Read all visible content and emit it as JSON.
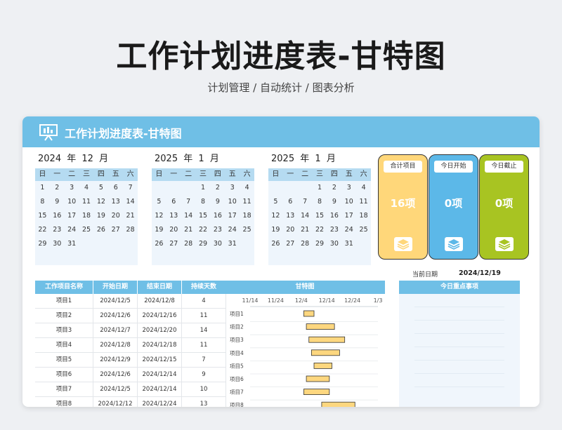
{
  "page": {
    "title": "工作计划进度表-甘特图",
    "subtitle": "计划管理 / 自动统计 / 图表分析"
  },
  "banner": {
    "title": "工作计划进度表-甘特图"
  },
  "calendars": [
    {
      "year": "2024",
      "year_unit": "年",
      "month": "12",
      "month_unit": "月",
      "weekdays": [
        "日",
        "一",
        "二",
        "三",
        "四",
        "五",
        "六"
      ],
      "rows": [
        [
          "1",
          "2",
          "3",
          "4",
          "5",
          "6",
          "7"
        ],
        [
          "8",
          "9",
          "10",
          "11",
          "12",
          "13",
          "14"
        ],
        [
          "15",
          "16",
          "17",
          "18",
          "19",
          "20",
          "21"
        ],
        [
          "22",
          "23",
          "24",
          "25",
          "26",
          "27",
          "28"
        ],
        [
          "29",
          "30",
          "31",
          "",
          "",
          "",
          ""
        ],
        [
          "",
          "",
          "",
          "",
          "",
          "",
          ""
        ]
      ]
    },
    {
      "year": "2025",
      "year_unit": "年",
      "month": "1",
      "month_unit": "月",
      "weekdays": [
        "日",
        "一",
        "二",
        "三",
        "四",
        "五",
        "六"
      ],
      "rows": [
        [
          "",
          "",
          "",
          "1",
          "2",
          "3",
          "4"
        ],
        [
          "5",
          "6",
          "7",
          "8",
          "9",
          "10",
          "11"
        ],
        [
          "12",
          "13",
          "14",
          "15",
          "16",
          "17",
          "18"
        ],
        [
          "19",
          "20",
          "21",
          "22",
          "23",
          "24",
          "25"
        ],
        [
          "26",
          "27",
          "28",
          "29",
          "30",
          "31",
          ""
        ],
        [
          "",
          "",
          "",
          "",
          "",
          "",
          ""
        ]
      ]
    },
    {
      "year": "2025",
      "year_unit": "年",
      "month": "1",
      "month_unit": "月",
      "weekdays": [
        "日",
        "一",
        "二",
        "三",
        "四",
        "五",
        "六"
      ],
      "rows": [
        [
          "",
          "",
          "",
          "1",
          "2",
          "3",
          "4"
        ],
        [
          "5",
          "6",
          "7",
          "8",
          "9",
          "10",
          "11"
        ],
        [
          "12",
          "13",
          "14",
          "15",
          "16",
          "17",
          "18"
        ],
        [
          "19",
          "20",
          "21",
          "22",
          "23",
          "24",
          "25"
        ],
        [
          "26",
          "27",
          "28",
          "29",
          "30",
          "31",
          ""
        ],
        [
          "",
          "",
          "",
          "",
          "",
          "",
          ""
        ]
      ]
    }
  ],
  "cards": [
    {
      "label": "合计项目",
      "value": "16项",
      "bg": "#ffd77a",
      "icon": "layers-icon"
    },
    {
      "label": "今日开始",
      "value": "0项",
      "bg": "#5cb8e8",
      "icon": "layers-icon"
    },
    {
      "label": "今日截止",
      "value": "0项",
      "bg": "#a8c422",
      "icon": "layers-icon"
    }
  ],
  "today": {
    "label": "当前日期",
    "value": "2024/12/19"
  },
  "table": {
    "headers": [
      "工作项目名称",
      "开始日期",
      "结束日期",
      "持续天数"
    ],
    "rows": [
      [
        "项目1",
        "2024/12/5",
        "2024/12/8",
        "4"
      ],
      [
        "项目2",
        "2024/12/6",
        "2024/12/16",
        "11"
      ],
      [
        "项目3",
        "2024/12/7",
        "2024/12/20",
        "14"
      ],
      [
        "项目4",
        "2024/12/8",
        "2024/12/18",
        "11"
      ],
      [
        "项目5",
        "2024/12/9",
        "2024/12/15",
        "7"
      ],
      [
        "项目6",
        "2024/12/6",
        "2024/12/14",
        "9"
      ],
      [
        "项目7",
        "2024/12/5",
        "2024/12/14",
        "10"
      ],
      [
        "项目8",
        "2024/12/12",
        "2024/12/24",
        "13"
      ]
    ]
  },
  "gantt": {
    "title": "甘特图",
    "ticks": [
      "11/14",
      "11/24",
      "12/4",
      "12/14",
      "12/24",
      "1/3"
    ],
    "bar_color": "#fdd77f"
  },
  "chart_data": {
    "type": "bar",
    "orientation": "horizontal-gantt",
    "title": "甘特图",
    "categories": [
      "项目1",
      "项目2",
      "项目3",
      "项目4",
      "项目5",
      "项目6",
      "项目7",
      "项目8"
    ],
    "start": [
      "2024-12-05",
      "2024-12-06",
      "2024-12-07",
      "2024-12-08",
      "2024-12-09",
      "2024-12-06",
      "2024-12-05",
      "2024-12-12"
    ],
    "duration_days": [
      4,
      11,
      14,
      11,
      7,
      9,
      10,
      13
    ],
    "xlim": [
      "2024-11-14",
      "2025-01-03"
    ],
    "xticks": [
      "11/14",
      "11/24",
      "12/4",
      "12/14",
      "12/24",
      "1/3"
    ]
  },
  "focus": {
    "title": "今日重点事项"
  }
}
